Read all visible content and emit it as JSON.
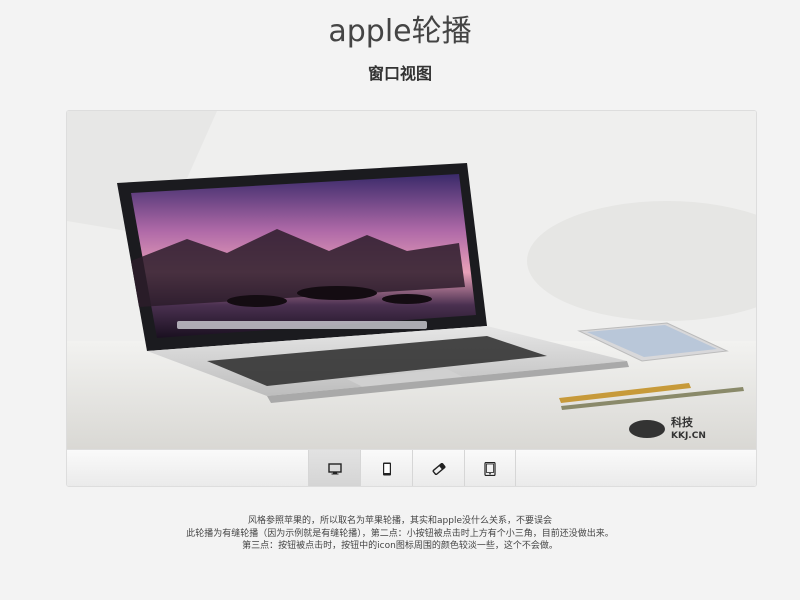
{
  "header": {
    "title": "apple轮播",
    "subtitle": "窗口视图"
  },
  "carousel": {
    "slide_watermark": "科技 KKJ.CN",
    "thumbnails": [
      {
        "name": "desktop-icon",
        "active": true
      },
      {
        "name": "phone-icon",
        "active": false
      },
      {
        "name": "ipod-icon",
        "active": false
      },
      {
        "name": "tablet-icon",
        "active": false
      }
    ]
  },
  "description": {
    "line1": "风格参照苹果的，所以取名为苹果轮播，其实和apple没什么关系，不要误会",
    "line2": "此轮播为有缝轮播（因为示例就是有缝轮播），第二点：小按钮被点击时上方有个小三角，目前还没做出来。",
    "line3": "第三点：按钮被点击时，按钮中的icon图标周围的颜色较淡一些，这个不会做。"
  }
}
